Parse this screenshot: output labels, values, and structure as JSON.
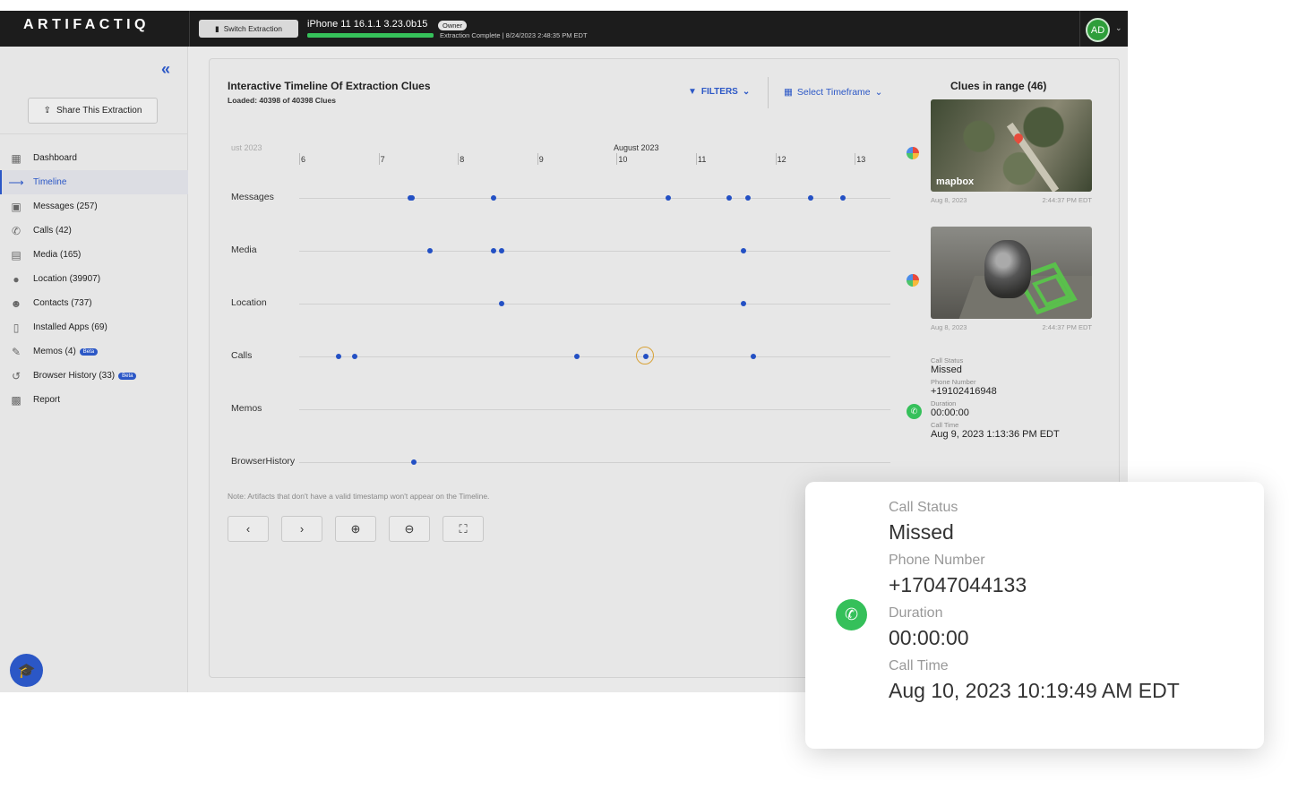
{
  "app": {
    "logo": "ARTIFACTIQ",
    "switch_label": "Switch Extraction",
    "device": "iPhone 11 16.1.1 3.23.0b15",
    "owner_badge": "Owner",
    "progress_percent": 100,
    "status": "Extraction Complete | 8/24/2023 2:48:35 PM EDT",
    "avatar": "AD"
  },
  "sidebar": {
    "share_label": "Share This Extraction",
    "items": [
      {
        "label": "Dashboard",
        "icon": "dashboard-icon"
      },
      {
        "label": "Timeline",
        "icon": "timeline-icon",
        "active": true
      },
      {
        "label": "Messages (257)",
        "icon": "message-icon"
      },
      {
        "label": "Calls (42)",
        "icon": "phone-icon"
      },
      {
        "label": "Media (165)",
        "icon": "film-icon"
      },
      {
        "label": "Location (39907)",
        "icon": "pin-icon"
      },
      {
        "label": "Contacts (737)",
        "icon": "person-icon"
      },
      {
        "label": "Installed Apps (69)",
        "icon": "mobile-icon"
      },
      {
        "label": "Memos (4)",
        "icon": "memo-icon",
        "badge": "Beta"
      },
      {
        "label": "Browser History (33)",
        "icon": "history-icon",
        "badge": "Beta"
      },
      {
        "label": "Report",
        "icon": "report-icon"
      }
    ]
  },
  "panel": {
    "title": "Interactive Timeline Of Extraction Clues",
    "subtitle": "Loaded: 40398 of 40398 Clues",
    "filters_label": "FILTERS",
    "timeframe_label": "Select Timeframe",
    "clues_title": "Clues in range (46)",
    "note": "Note: Artifacts that don't have a valid timestamp won't appear on the Timeline."
  },
  "timeline": {
    "month_left": "ust 2023",
    "month_center": "August 2023",
    "ticks": [
      "6",
      "7",
      "8",
      "9",
      "10",
      "11",
      "12",
      "13"
    ],
    "rows": [
      {
        "label": "Messages",
        "points": [
          7.4,
          7.42,
          8.45,
          10.65,
          11.42,
          11.65,
          12.45,
          12.85
        ]
      },
      {
        "label": "Media",
        "points": [
          7.65,
          8.45,
          8.55,
          11.6
        ]
      },
      {
        "label": "Location",
        "points": [
          8.55,
          11.6
        ]
      },
      {
        "label": "Calls",
        "points": [
          6.5,
          6.7,
          9.5,
          10.37,
          11.72
        ],
        "selected_index": 3
      },
      {
        "label": "Memos",
        "points": []
      },
      {
        "label": "BrowserHistory",
        "points": [
          7.45
        ]
      }
    ]
  },
  "clues": [
    {
      "date": "Aug 8, 2023",
      "time": "2:44:37 PM EDT",
      "thumb_text": "mapbox"
    },
    {
      "date": "Aug 8, 2023",
      "time": "2:44:37 PM EDT"
    }
  ],
  "call_card": {
    "status_label": "Call Status",
    "status": "Missed",
    "phone_label": "Phone Number",
    "phone": "+19102416948",
    "duration_label": "Duration",
    "duration": "00:00:00",
    "time_label": "Call Time",
    "time": "Aug 9, 2023 1:13:36 PM EDT"
  },
  "popup": {
    "status_label": "Call Status",
    "status": "Missed",
    "phone_label": "Phone Number",
    "phone": "+17047044133",
    "duration_label": "Duration",
    "duration": "00:00:00",
    "time_label": "Call Time",
    "time": "Aug 10, 2023 10:19:49 AM EDT"
  },
  "colors": {
    "accent": "#2b57c6",
    "success": "#35c05a",
    "highlight": "#d8a238",
    "topbar": "#1c1c1c"
  }
}
